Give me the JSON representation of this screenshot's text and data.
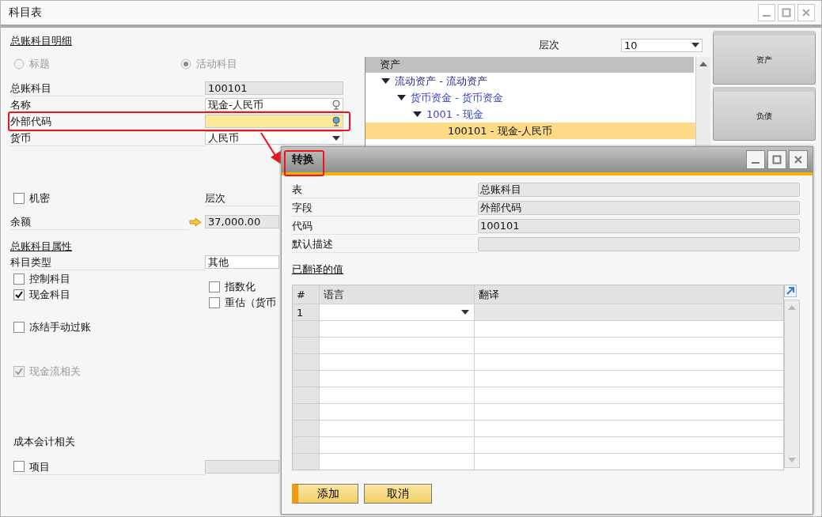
{
  "window": {
    "title": "科目表"
  },
  "details": {
    "heading": "总账科目明细",
    "radios": [
      {
        "label": "标题",
        "selected": false,
        "disabled": true
      },
      {
        "label": "活动科目",
        "selected": true,
        "disabled": true
      }
    ],
    "fields": [
      {
        "label": "总账科目",
        "value": "100101",
        "kind": "readonly"
      },
      {
        "label": "名称",
        "value": "现金-人民币",
        "kind": "lookup"
      },
      {
        "label": "外部代码",
        "kind": "highlight"
      },
      {
        "label": "货币",
        "value": "人民币",
        "kind": "dropdown"
      }
    ],
    "confidential": {
      "label": "机密",
      "checked": false
    },
    "level_label": "层次",
    "balance": {
      "label": "余额",
      "value": "37,000.00"
    }
  },
  "properties": {
    "heading": "总账科目属性",
    "account_type": {
      "label": "科目类型",
      "value": "其他"
    },
    "left_checks": [
      {
        "label": "控制科目",
        "checked": false,
        "disabled": false
      },
      {
        "label": "现金科目",
        "checked": true,
        "disabled": false
      },
      {
        "label": "冻结手动过账",
        "checked": false,
        "disabled": false
      },
      {
        "label": "现金流相关",
        "checked": true,
        "disabled": true
      }
    ],
    "right_checks": [
      {
        "label": "指数化",
        "checked": false
      },
      {
        "label": "重估（货币",
        "checked": false
      }
    ]
  },
  "cost_accounting": {
    "heading": "成本会计相关",
    "project": {
      "label": "项目",
      "checked": false
    }
  },
  "level": {
    "label": "层次",
    "value": "10"
  },
  "tree": {
    "header": "资产",
    "items": [
      {
        "label": "流动资产 - 流动资产",
        "expanded": true,
        "selected": false,
        "children": [
          {
            "label": "货币资金 - 货币资金",
            "expanded": true,
            "selected": false,
            "children": [
              {
                "label": "1001 - 现金",
                "expanded": true,
                "selected": false,
                "children": [
                  {
                    "label": "100101 - 现金-人民币",
                    "selected": true
                  }
                ]
              }
            ]
          }
        ]
      }
    ]
  },
  "drawers": [
    {
      "label": "资产"
    },
    {
      "label": "负债"
    }
  ],
  "dialog": {
    "title": "转换",
    "fields": [
      {
        "label": "表",
        "value": "总账科目"
      },
      {
        "label": "字段",
        "value": "外部代码"
      },
      {
        "label": "代码",
        "value": "100101"
      },
      {
        "label": "默认描述"
      }
    ],
    "section": "已翻译的值",
    "table": {
      "columns": [
        "#",
        "语言",
        "翻译"
      ],
      "rows": [
        {
          "number": "1"
        }
      ]
    },
    "buttons": [
      {
        "label": "添加",
        "kind": "primary"
      },
      {
        "label": "取消",
        "kind": "secondary"
      }
    ]
  }
}
